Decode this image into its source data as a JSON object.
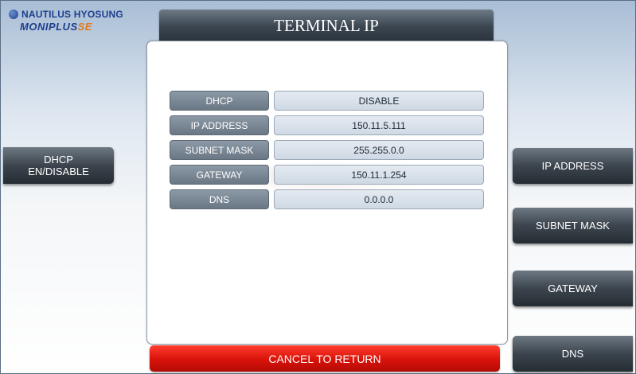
{
  "brand": {
    "company": "NAUTILUS HYOSUNG",
    "product_main": "MONIPLUS",
    "product_suffix": "SE"
  },
  "title": "TERMINAL IP",
  "settings": [
    {
      "label": "DHCP",
      "value": "DISABLE"
    },
    {
      "label": "IP ADDRESS",
      "value": "150.11.5.111"
    },
    {
      "label": "SUBNET MASK",
      "value": "255.255.0.0"
    },
    {
      "label": "GATEWAY",
      "value": "150.11.1.254"
    },
    {
      "label": "DNS",
      "value": "0.0.0.0"
    }
  ],
  "left_buttons": {
    "dhcp_line1": "DHCP",
    "dhcp_line2": "EN/DISABLE"
  },
  "right_buttons": {
    "ip_address": "IP ADDRESS",
    "subnet_mask": "SUBNET MASK",
    "gateway": "GATEWAY",
    "dns": "DNS"
  },
  "cancel_label": "CANCEL TO RETURN",
  "colors": {
    "cancel": "#d8120a",
    "button_dark": "#3c454e",
    "label_cell": "#7a8795",
    "value_cell": "#d8e1eb"
  }
}
